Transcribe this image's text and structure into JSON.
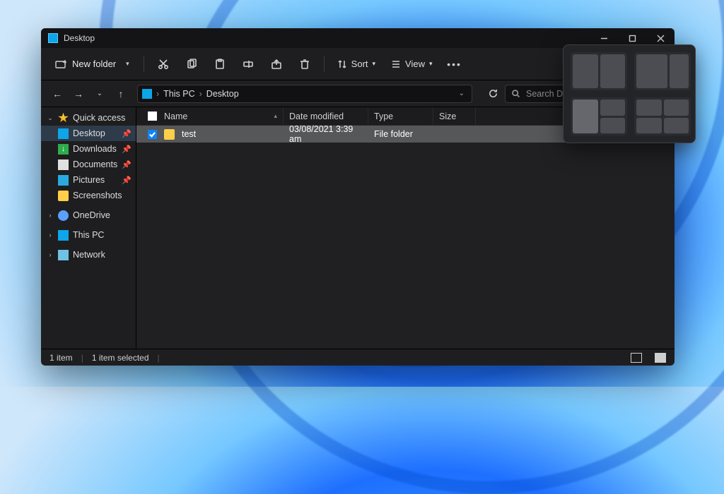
{
  "title": "Desktop",
  "commandbar": {
    "new_folder": "New folder",
    "sort": "Sort",
    "view": "View"
  },
  "nav": {
    "crumbs": [
      "This PC",
      "Desktop"
    ]
  },
  "search": {
    "placeholder": "Search Desktop"
  },
  "sidebar": {
    "quick_access": "Quick access",
    "items": [
      {
        "label": "Desktop"
      },
      {
        "label": "Downloads"
      },
      {
        "label": "Documents"
      },
      {
        "label": "Pictures"
      },
      {
        "label": "Screenshots"
      }
    ],
    "onedrive": "OneDrive",
    "thispc": "This PC",
    "network": "Network"
  },
  "columns": {
    "name": "Name",
    "date": "Date modified",
    "type": "Type",
    "size": "Size"
  },
  "rows": [
    {
      "name": "test",
      "date": "03/08/2021 3:39 am",
      "type": "File folder",
      "size": ""
    }
  ],
  "status": {
    "count": "1 item",
    "selected": "1 item selected"
  }
}
